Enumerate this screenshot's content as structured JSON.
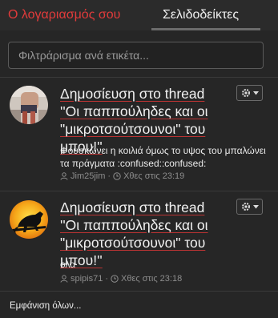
{
  "tabs": {
    "account": "Ο λογαριασμός σου",
    "bookmarks": "Σελιδοδείκτες"
  },
  "search": {
    "placeholder": "Φιλτράρισμα ανά ετικέτα..."
  },
  "bookmarks": [
    {
      "title": "Δημοσίευση στο thread ''Οι παππούληδες και οι \"μικροτσούτσουνοι\" του μπου!''",
      "snippet": "Φουσκώνει η κοιλιά όμως το υψος του μπαλώνει τα πράγματα :confused::confused:",
      "user": "Jim25jim",
      "time": "Χθες στις 23:19",
      "avatar_icon": "user-photo-avatar"
    },
    {
      "title": "Δημοσίευση στο thread ''Οι παππούληδες και οι \"μικροτσούτσουνοι\" του μπου!''",
      "snippet": "ολα",
      "user": "spipis71",
      "time": "Χθες στις 23:18",
      "avatar_icon": "panther-avatar"
    }
  ],
  "footer": {
    "show_all": "Εμφάνιση όλων..."
  },
  "colors": {
    "accent_red": "#e23b3b",
    "background": "#262626"
  }
}
